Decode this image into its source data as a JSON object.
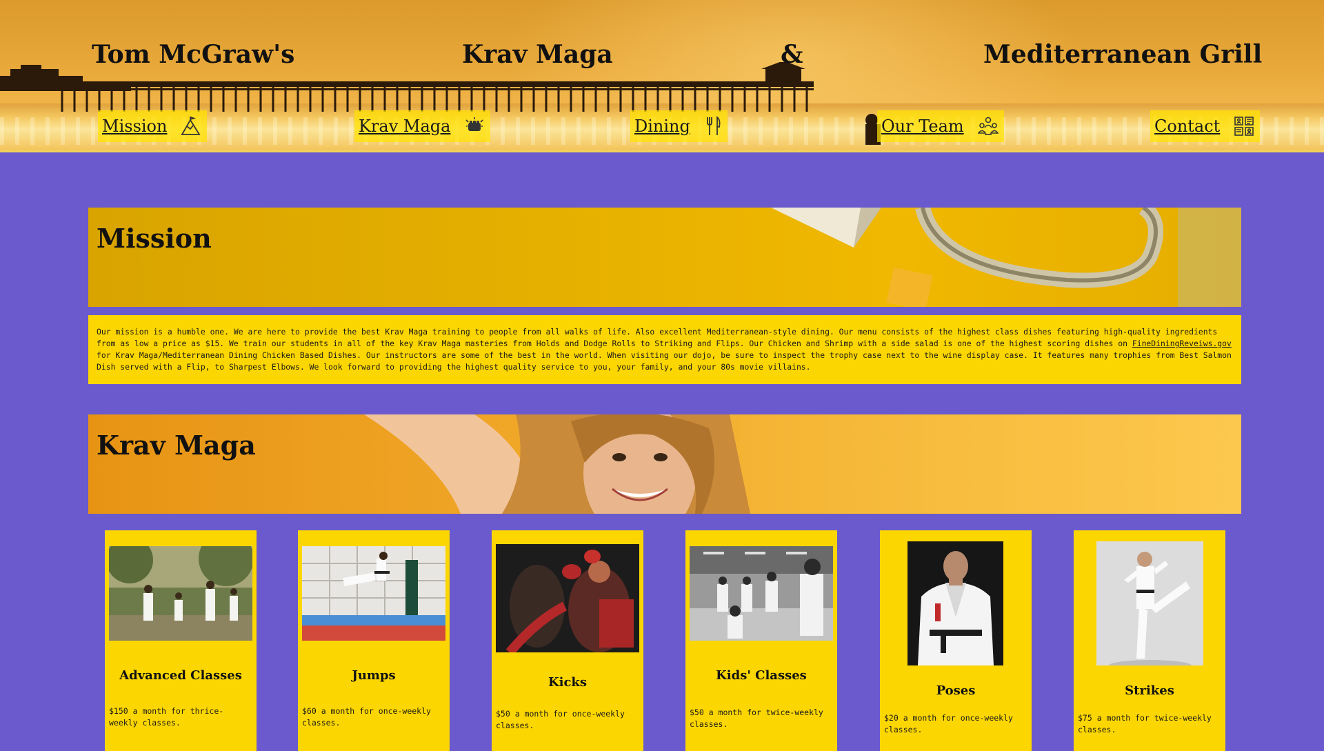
{
  "header": {
    "title_parts": [
      "Tom McGraw's",
      "Krav Maga",
      "&",
      "Mediterranean Grill"
    ]
  },
  "nav": [
    {
      "label": "Mission",
      "icon": "mountain-icon"
    },
    {
      "label": "Krav Maga",
      "icon": "fist-icon"
    },
    {
      "label": "Dining",
      "icon": "utensils-icon"
    },
    {
      "label": "Our Team",
      "icon": "team-icon"
    },
    {
      "label": "Contact",
      "icon": "contact-card-icon"
    }
  ],
  "mission": {
    "heading": "Mission",
    "text_before_link": "Our mission is a humble one. We are here to provide the best Krav Maga training to people from all walks of life. Also excellent Mediterranean-style dining. Our menu consists of the highest class dishes featuring high-quality ingredients from as low a price as $15. We train our students in all of the key Krav Maga masteries from Holds and Dodge Rolls to Striking and Flips. Our Chicken and Shrimp with a side salad is one of the highest scoring dishes on ",
    "link": "FineDiningReveiws.gov",
    "text_after_link": " for Krav Maga/Mediterranean Dining Chicken Based Dishes. Our instructors are some of the best in the world. When visiting our dojo, be sure to inspect the trophy case next to the wine display case. It features many trophies from Best Salmon Dish served with a Flip, to Sharpest Elbows. We look forward to providing the highest quality service to you, your family, and your 80s movie villains."
  },
  "krav": {
    "heading": "Krav Maga",
    "classes": [
      {
        "title": "Advanced Classes",
        "price": "$150 a month for thrice-weekly classes."
      },
      {
        "title": "Jumps",
        "price": "$60 a month for once-weekly classes."
      },
      {
        "title": "Kicks",
        "price": "$50 a month for once-weekly classes."
      },
      {
        "title": "Kids' Classes",
        "price": "$50 a month for twice-weekly classes."
      },
      {
        "title": "Poses",
        "price": "$20 a month for once-weekly classes."
      },
      {
        "title": "Strikes",
        "price": "$75 a month for twice-weekly classes."
      }
    ]
  },
  "colors": {
    "page_bg": "#6a5acd",
    "accent_yellow": "#fcd600",
    "header_orange": "#e8a83a"
  }
}
